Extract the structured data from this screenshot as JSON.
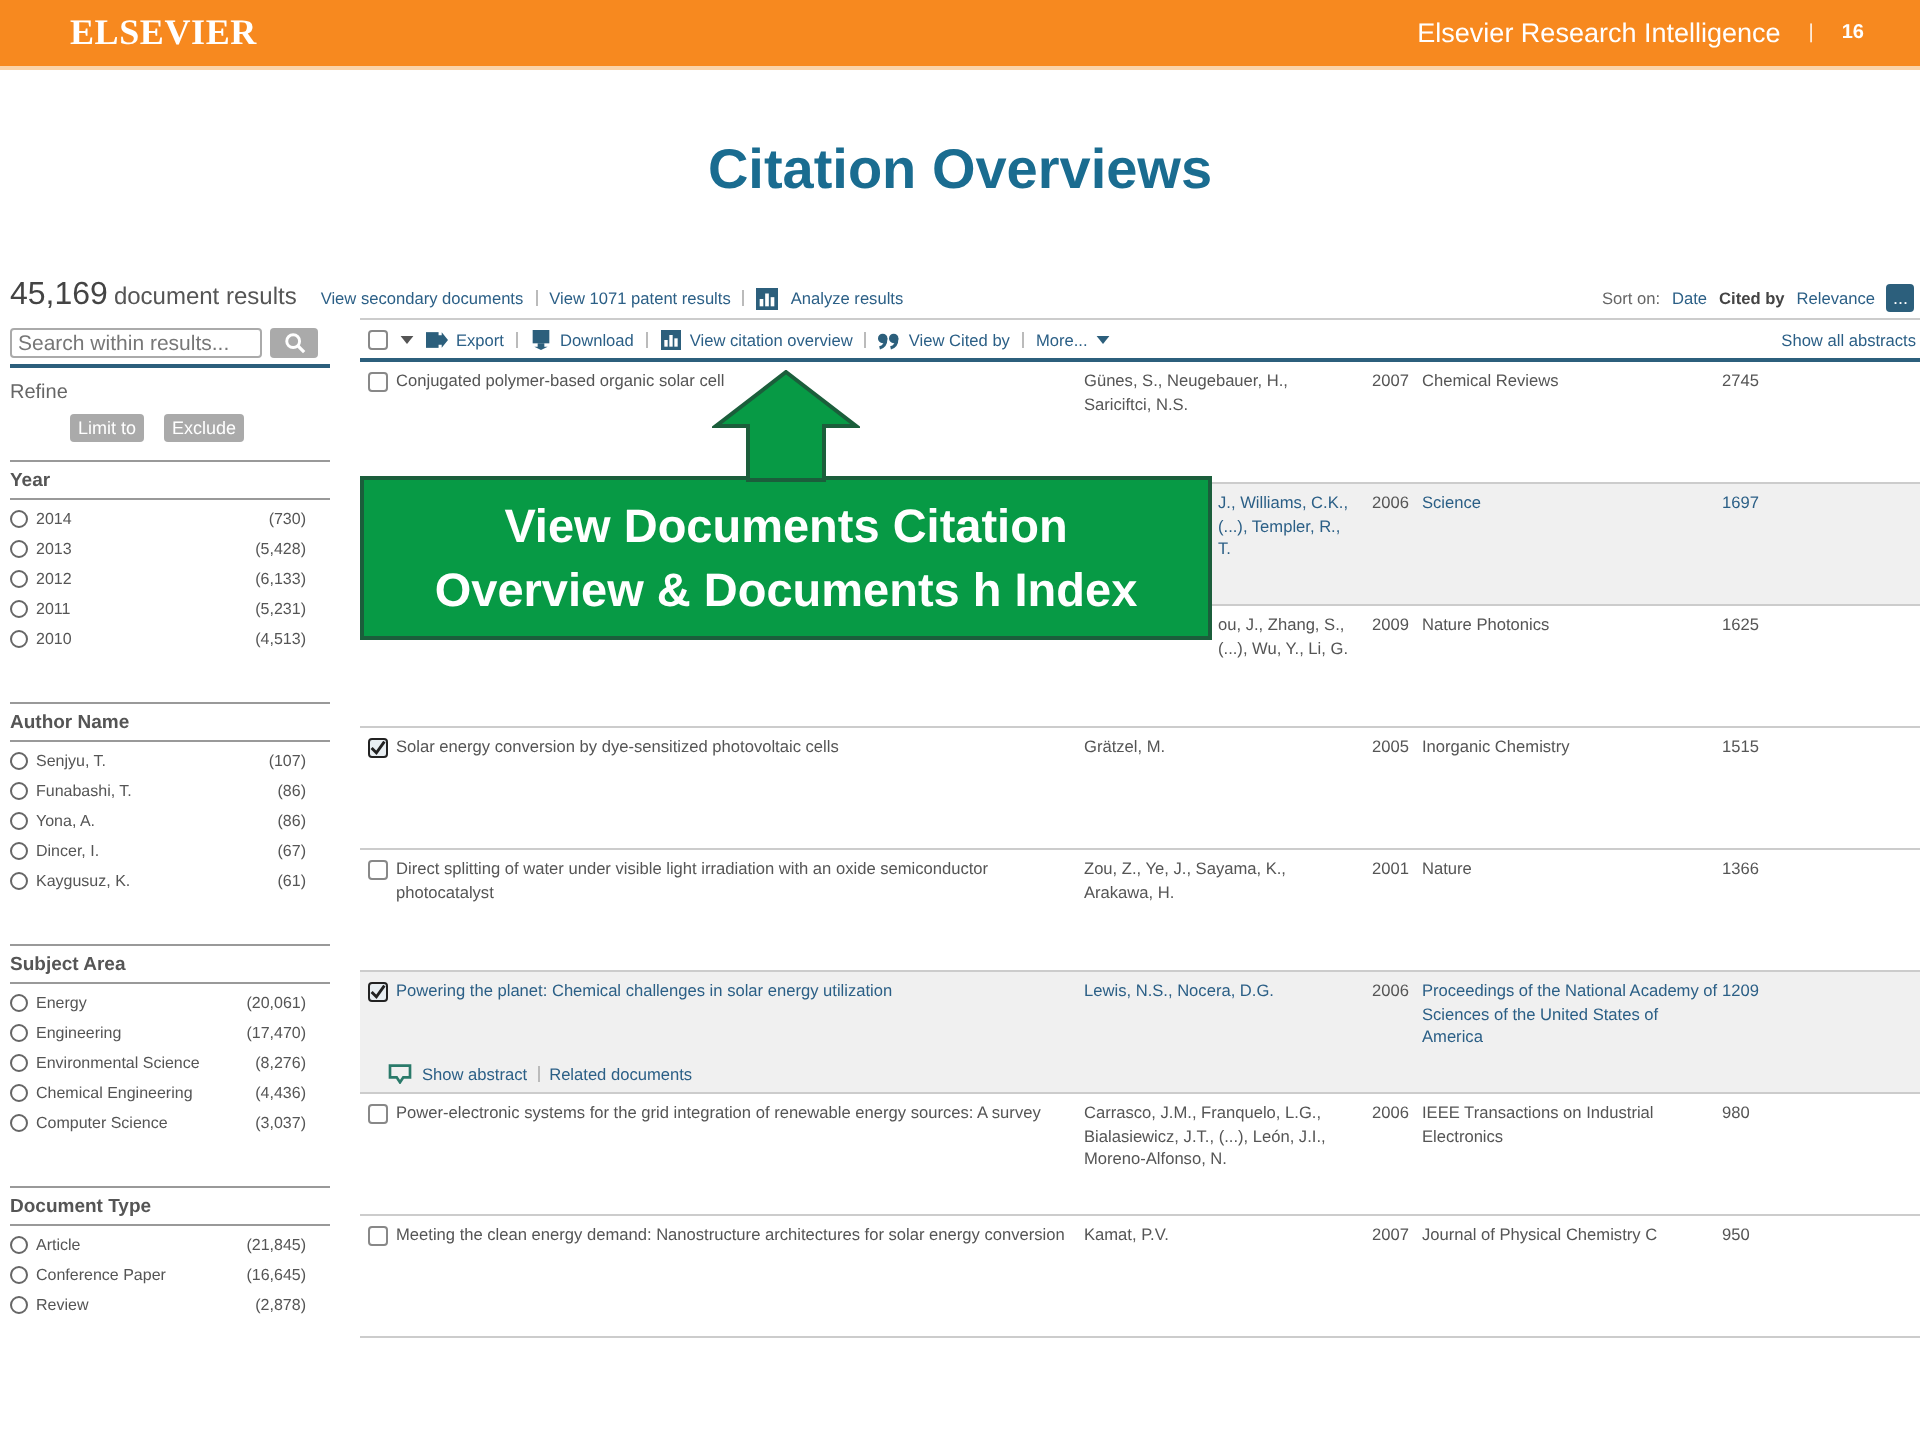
{
  "header": {
    "brand": "ELSEVIER",
    "product": "Elsevier Research Intelligence",
    "separator": "|",
    "page": "16"
  },
  "slide_title": "Citation Overviews",
  "results": {
    "count": "45,169",
    "count_label": "document results",
    "links": [
      "View secondary documents",
      "View 1071 patent results"
    ],
    "analyze": "Analyze results",
    "sort_label": "Sort on:",
    "sort_options": [
      {
        "label": "Date",
        "selected": false
      },
      {
        "label": "Cited by",
        "selected": true
      },
      {
        "label": "Relevance",
        "selected": false
      }
    ],
    "more_button": "..."
  },
  "search": {
    "placeholder": "Search within results..."
  },
  "refine": {
    "title": "Refine",
    "buttons": [
      "Limit to",
      "Exclude"
    ]
  },
  "facets": [
    {
      "title": "Year",
      "items": [
        {
          "label": "2014",
          "count": "(730)",
          "checked": false
        },
        {
          "label": "2013",
          "count": "(5,428)",
          "checked": false
        },
        {
          "label": "2012",
          "count": "(6,133)",
          "checked": false
        },
        {
          "label": "2011",
          "count": "(5,231)",
          "checked": false
        },
        {
          "label": "2010",
          "count": "(4,513)",
          "checked": false
        }
      ]
    },
    {
      "title": "Author Name",
      "items": [
        {
          "label": "Senjyu, T.",
          "count": "(107)",
          "checked": false
        },
        {
          "label": "Funabashi, T.",
          "count": "(86)",
          "checked": false
        },
        {
          "label": "Yona, A.",
          "count": "(86)",
          "checked": false
        },
        {
          "label": "Dincer, I.",
          "count": "(67)",
          "checked": false
        },
        {
          "label": "Kaygusuz, K.",
          "count": "(61)",
          "checked": false
        }
      ]
    },
    {
      "title": "Subject Area",
      "items": [
        {
          "label": "Energy",
          "count": "(20,061)",
          "checked": false
        },
        {
          "label": "Engineering",
          "count": "(17,470)",
          "checked": false
        },
        {
          "label": "Environmental Science",
          "count": "(8,276)",
          "checked": false
        },
        {
          "label": "Chemical Engineering",
          "count": "(4,436)",
          "checked": false
        },
        {
          "label": "Computer Science",
          "count": "(3,037)",
          "checked": false
        }
      ]
    },
    {
      "title": "Document Type",
      "items": [
        {
          "label": "Article",
          "count": "(21,845)",
          "checked": false
        },
        {
          "label": "Conference Paper",
          "count": "(16,645)",
          "checked": false
        },
        {
          "label": "Review",
          "count": "(2,878)",
          "checked": false
        }
      ]
    }
  ],
  "toolbar": {
    "select_all_checked": false,
    "actions": [
      {
        "kind": "export",
        "label": "Export"
      },
      {
        "kind": "download",
        "label": "Download"
      },
      {
        "kind": "chart",
        "label": "View citation overview"
      },
      {
        "kind": "quote",
        "label": "View Cited by"
      }
    ],
    "more": "More...",
    "show_all": "Show all abstracts"
  },
  "rows": [
    {
      "title": "Conjugated polymer-based organic solar cell",
      "authors": "Günes, S., Neugebauer, H., Sariciftci, N.S.",
      "year": "2007",
      "source": "Chemical Reviews",
      "cited_by": "2745",
      "checked": false,
      "highlighted": false,
      "covered": false
    },
    {
      "authors": "J., Williams, C.K.,\n(...), Templer, R.,\nT.",
      "year": "2006",
      "source": "Science",
      "cited_by": "1697",
      "highlighted": true,
      "covered": true
    },
    {
      "authors": "ou, J., Zhang, S.,\n(...), Wu, Y., Li, G.",
      "year": "2009",
      "source": "Nature Photonics",
      "cited_by": "1625",
      "highlighted": false,
      "covered": true
    },
    {
      "title": "Solar energy conversion by dye-sensitized photovoltaic cells",
      "authors": "Grätzel, M.",
      "year": "2005",
      "source": "Inorganic Chemistry",
      "cited_by": "1515",
      "checked": true,
      "highlighted": false,
      "covered": false
    },
    {
      "title": "Direct splitting of water under visible light irradiation with an oxide semiconductor photocatalyst",
      "authors": "Zou, Z., Ye, J., Sayama, K., Arakawa, H.",
      "year": "2001",
      "source": "Nature",
      "cited_by": "1366",
      "checked": false,
      "highlighted": false,
      "covered": false
    },
    {
      "title": "Powering the planet: Chemical challenges in solar energy utilization",
      "authors": "Lewis, N.S., Nocera, D.G.",
      "year": "2006",
      "source": "Proceedings of the National Academy of Sciences of the United States of America",
      "cited_by": "1209",
      "checked": true,
      "highlighted": true,
      "covered": false,
      "row_links": [
        "Show abstract",
        "Related documents"
      ]
    },
    {
      "title": "Power-electronic systems for the grid integration of renewable energy sources: A survey",
      "authors": "Carrasco, J.M., Franquelo, L.G., Bialasiewicz, J.T., (...), León, J.I., Moreno-Alfonso, N.",
      "year": "2006",
      "source": "IEEE Transactions on Industrial Electronics",
      "cited_by": "980",
      "checked": false,
      "highlighted": false,
      "covered": false
    },
    {
      "title": "Meeting the clean energy demand: Nanostructure architectures for solar energy conversion",
      "authors": "Kamat, P.V.",
      "year": "2007",
      "source": "Journal of Physical Chemistry C",
      "cited_by": "950",
      "checked": false,
      "highlighted": false,
      "covered": false
    }
  ],
  "callout": {
    "lines": [
      "View Documents Citation",
      "Overview & Documents h Index"
    ]
  }
}
